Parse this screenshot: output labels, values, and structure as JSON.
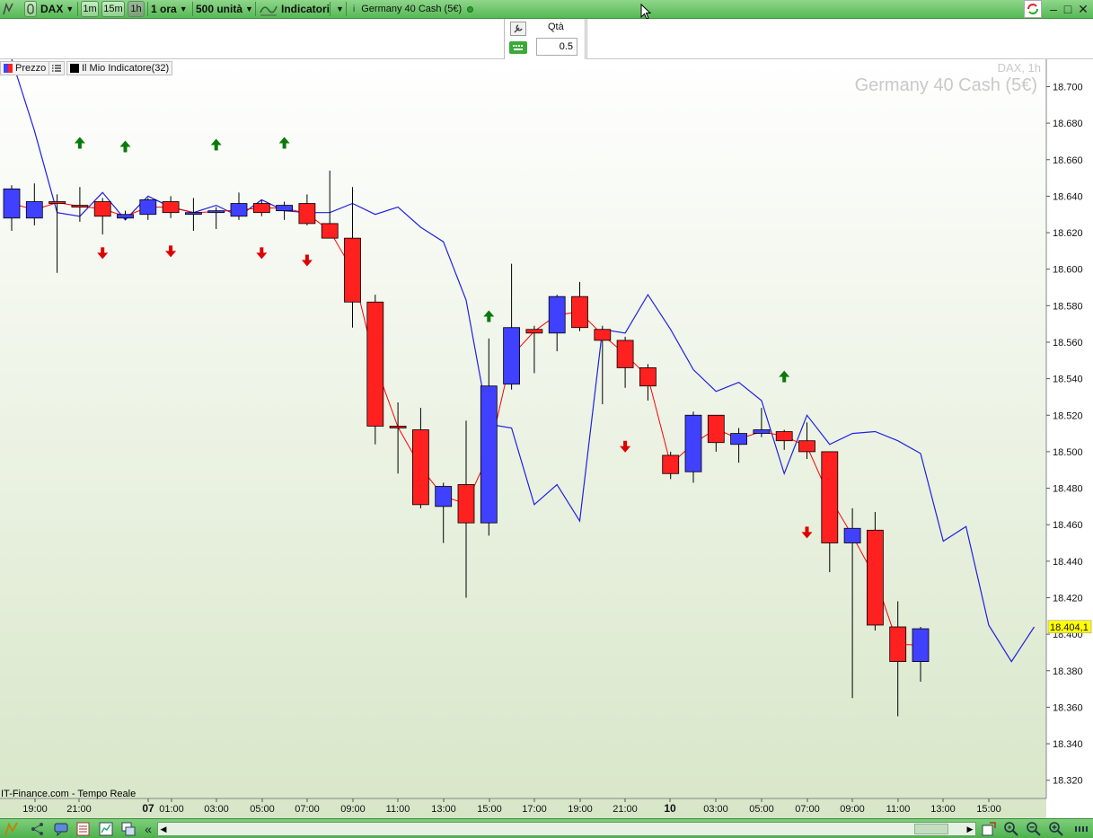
{
  "toolbar": {
    "symbol": "DAX",
    "timeframes": [
      "1m",
      "15m",
      "1h"
    ],
    "active_timeframe": "1h",
    "period": "1 ora",
    "units": "500 unità",
    "indicators_label": "Indicatori",
    "instrument_tab": "Germany 40 Cash (5€)"
  },
  "order": {
    "qty_label": "Qtà",
    "qty_value": "0.5"
  },
  "legend": {
    "price_label": "Prezzo",
    "indicator_label": "Il Mio Indicatore(32)"
  },
  "watermark": {
    "symbol_tf": "DAX, 1h",
    "instrument": "Germany 40 Cash (5€)"
  },
  "footer_text": "IT-Finance.com - Tempo Reale",
  "colors": {
    "up_candle": "#4040ff",
    "down_candle": "#ff2020",
    "indicator_line": "#2020e0",
    "mid_line": "#ff0000",
    "buy_arrow": "#0a7a0a",
    "sell_arrow": "#dd0000",
    "last_price_bg": "#ffff00"
  },
  "chart_data": {
    "type": "candlestick",
    "ylim": [
      18310,
      18715
    ],
    "y_ticks": [
      "18.700",
      "18.680",
      "18.660",
      "18.640",
      "18.620",
      "18.600",
      "18.580",
      "18.560",
      "18.540",
      "18.520",
      "18.500",
      "18.480",
      "18.460",
      "18.440",
      "18.420",
      "18.400",
      "18.380",
      "18.360",
      "18.340",
      "18.320"
    ],
    "x_labels": [
      "19:00",
      "21:00",
      "07",
      "01:00",
      "03:00",
      "05:00",
      "07:00",
      "09:00",
      "11:00",
      "13:00",
      "15:00",
      "17:00",
      "19:00",
      "21:00",
      "10",
      "03:00",
      "05:00",
      "07:00",
      "09:00",
      "11:00",
      "13:00",
      "15:00"
    ],
    "last_price_label": "18.404,1",
    "candles": [
      {
        "o": 18628,
        "h": 18646,
        "l": 18621,
        "c": 18644
      },
      {
        "o": 18628,
        "h": 18647,
        "l": 18624,
        "c": 18637
      },
      {
        "o": 18637,
        "h": 18641,
        "l": 18598,
        "c": 18636
      },
      {
        "o": 18635,
        "h": 18645,
        "l": 18626,
        "c": 18634
      },
      {
        "o": 18637,
        "h": 18639,
        "l": 18619,
        "c": 18629
      },
      {
        "o": 18628,
        "h": 18632,
        "l": 18627,
        "c": 18630
      },
      {
        "o": 18630,
        "h": 18639,
        "l": 18627,
        "c": 18638
      },
      {
        "o": 18637,
        "h": 18640,
        "l": 18628,
        "c": 18631
      },
      {
        "o": 18631,
        "h": 18639,
        "l": 18621,
        "c": 18631
      },
      {
        "o": 18631,
        "h": 18634,
        "l": 18622,
        "c": 18632
      },
      {
        "o": 18629,
        "h": 18642,
        "l": 18627,
        "c": 18636
      },
      {
        "o": 18636,
        "h": 18638,
        "l": 18629,
        "c": 18631
      },
      {
        "o": 18632,
        "h": 18637,
        "l": 18627,
        "c": 18635
      },
      {
        "o": 18636,
        "h": 18641,
        "l": 18624,
        "c": 18625
      },
      {
        "o": 18625,
        "h": 18654,
        "l": 18619,
        "c": 18617
      },
      {
        "o": 18617,
        "h": 18645,
        "l": 18568,
        "c": 18582
      },
      {
        "o": 18582,
        "h": 18586,
        "l": 18504,
        "c": 18514
      },
      {
        "o": 18514,
        "h": 18527,
        "l": 18488,
        "c": 18513
      },
      {
        "o": 18512,
        "h": 18524,
        "l": 18469,
        "c": 18471
      },
      {
        "o": 18470,
        "h": 18483,
        "l": 18450,
        "c": 18481
      },
      {
        "o": 18482,
        "h": 18517,
        "l": 18420,
        "c": 18461
      },
      {
        "o": 18461,
        "h": 18562,
        "l": 18454,
        "c": 18536
      },
      {
        "o": 18537,
        "h": 18603,
        "l": 18534,
        "c": 18568
      },
      {
        "o": 18567,
        "h": 18569,
        "l": 18543,
        "c": 18565
      },
      {
        "o": 18565,
        "h": 18586,
        "l": 18555,
        "c": 18585
      },
      {
        "o": 18585,
        "h": 18593,
        "l": 18566,
        "c": 18568
      },
      {
        "o": 18567,
        "h": 18569,
        "l": 18526,
        "c": 18561
      },
      {
        "o": 18561,
        "h": 18563,
        "l": 18535,
        "c": 18546
      },
      {
        "o": 18546,
        "h": 18548,
        "l": 18528,
        "c": 18536
      },
      {
        "o": 18498,
        "h": 18500,
        "l": 18485,
        "c": 18488
      },
      {
        "o": 18489,
        "h": 18522,
        "l": 18483,
        "c": 18520
      },
      {
        "o": 18520,
        "h": 18520,
        "l": 18500,
        "c": 18505
      },
      {
        "o": 18504,
        "h": 18513,
        "l": 18494,
        "c": 18510
      },
      {
        "o": 18510,
        "h": 18524,
        "l": 18508,
        "c": 18512
      },
      {
        "o": 18511,
        "h": 18512,
        "l": 18501,
        "c": 18506
      },
      {
        "o": 18506,
        "h": 18516,
        "l": 18496,
        "c": 18500
      },
      {
        "o": 18500,
        "h": 18500,
        "l": 18434,
        "c": 18450
      },
      {
        "o": 18450,
        "h": 18469,
        "l": 18365,
        "c": 18458
      },
      {
        "o": 18457,
        "h": 18467,
        "l": 18402,
        "c": 18405
      },
      {
        "o": 18404,
        "h": 18418,
        "l": 18355,
        "c": 18385
      },
      {
        "o": 18385,
        "h": 18404,
        "l": 18374,
        "c": 18403
      }
    ],
    "indicator_line": [
      18715,
      18676,
      18631,
      18629,
      18642,
      18627,
      18640,
      18634,
      18631,
      18635,
      18629,
      18638,
      18632,
      18631,
      18631,
      18636,
      18630,
      18634,
      18623,
      18615,
      18583,
      18515,
      18513,
      18471,
      18482,
      18462,
      18567,
      18565,
      18586,
      18567,
      18545,
      18533,
      18538,
      18528,
      18488,
      18520,
      18504,
      18510,
      18511,
      18506,
      18499,
      18451,
      18459,
      18405,
      18385,
      18404
    ],
    "buy_arrows": [
      {
        "i": 3,
        "y": 18669
      },
      {
        "i": 5,
        "y": 18667
      },
      {
        "i": 9,
        "y": 18668
      },
      {
        "i": 12,
        "y": 18669
      },
      {
        "i": 21,
        "y": 18574
      },
      {
        "i": 34,
        "y": 18541
      }
    ],
    "sell_arrows": [
      {
        "i": 4,
        "y": 18609
      },
      {
        "i": 7,
        "y": 18610
      },
      {
        "i": 11,
        "y": 18609
      },
      {
        "i": 13,
        "y": 18605
      },
      {
        "i": 27,
        "y": 18503
      },
      {
        "i": 35,
        "y": 18456
      }
    ]
  },
  "bottom_icons": [
    "draw-pencil-icon",
    "share-icon",
    "comment-icon",
    "list-icon",
    "chart-icon",
    "windows-icon",
    "collapse-left-icon",
    "scroll-left-icon",
    "scroll-right-icon",
    "chart-settings-icon",
    "zoom-auto-icon",
    "zoom-out-icon",
    "zoom-in-icon",
    "bar-spacing-icon"
  ]
}
